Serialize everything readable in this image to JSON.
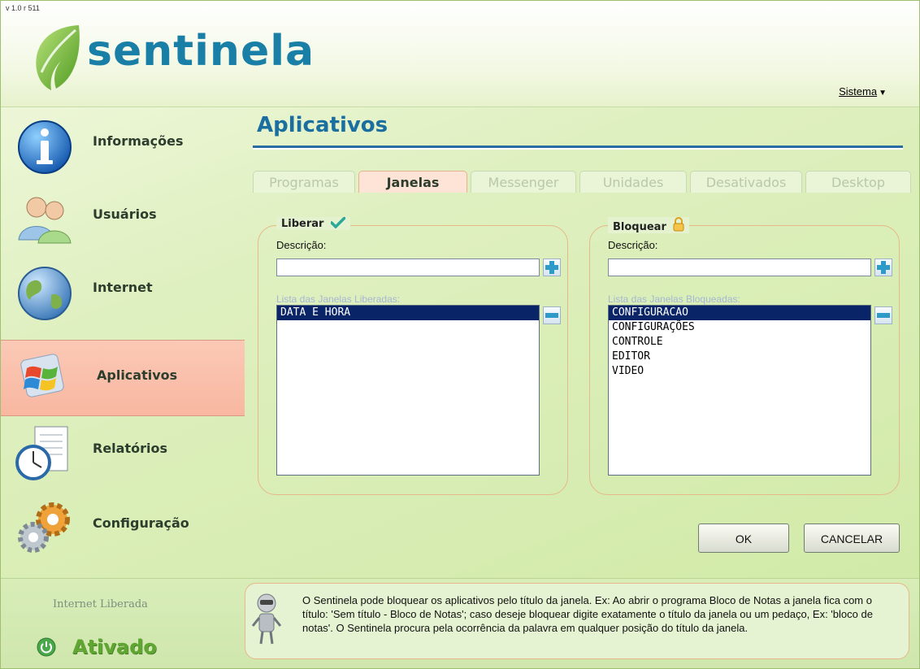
{
  "app": {
    "version": "v 1.0 r 511",
    "logo_text": "sentinela",
    "menu": {
      "sistema_label": "Sistema"
    }
  },
  "sidebar": {
    "items": [
      {
        "label": "Informações",
        "icon": "info-icon",
        "active": false
      },
      {
        "label": "Usuários",
        "icon": "users-icon",
        "active": false
      },
      {
        "label": "Internet",
        "icon": "globe-icon",
        "active": false
      },
      {
        "label": "Aplicativos",
        "icon": "windows-logo-icon",
        "active": true
      },
      {
        "label": "Relatórios",
        "icon": "report-clock-icon",
        "active": false
      },
      {
        "label": "Configuração",
        "icon": "gears-icon",
        "active": false
      }
    ]
  },
  "main": {
    "title": "Aplicativos",
    "tabs": [
      {
        "label": "Programas",
        "active": false
      },
      {
        "label": "Janelas",
        "active": true
      },
      {
        "label": "Messenger",
        "active": false
      },
      {
        "label": "Unidades",
        "active": false
      },
      {
        "label": "Desativados",
        "active": false
      },
      {
        "label": "Desktop",
        "active": false
      }
    ],
    "liberar": {
      "title": "Liberar",
      "icon": "checkmark-icon",
      "desc_label": "Descrição:",
      "desc_value": "",
      "list_caption": "Lista das Janelas Liberadas:",
      "items": [
        "DATA E HORA"
      ],
      "selected_index": 0
    },
    "bloquear": {
      "title": "Bloquear",
      "icon": "padlock-icon",
      "desc_label": "Descrição:",
      "desc_value": "",
      "list_caption": "Lista das Janelas Bloqueadas:",
      "items": [
        "CONFIGURACAO",
        "CONFIGURAÇÕES",
        "CONTROLE",
        "EDITOR",
        "VIDEO"
      ],
      "selected_index": 0
    },
    "buttons": {
      "ok_label": "OK",
      "cancel_label": "CANCELAR"
    }
  },
  "footer": {
    "internet_status": "Internet Liberada",
    "activation_status": "Ativado",
    "tip": "O Sentinela pode bloquear os aplicativos pelo título da janela. Ex: Ao abrir o programa Bloco de Notas a janela fica com o título: 'Sem título - Bloco de Notas'; caso deseje bloquear digite exatamente o título da janela ou um pedaço, Ex: 'bloco de notas'. O Sentinela procura pela ocorrência da palavra em qualquer posição do título da janela."
  },
  "colors": {
    "brand_blue": "#1a7fa6",
    "title_blue": "#1b6fa0",
    "active_nav": "#f8b7a0",
    "selection": "#0a2468",
    "activated_green": "#5fa630"
  }
}
